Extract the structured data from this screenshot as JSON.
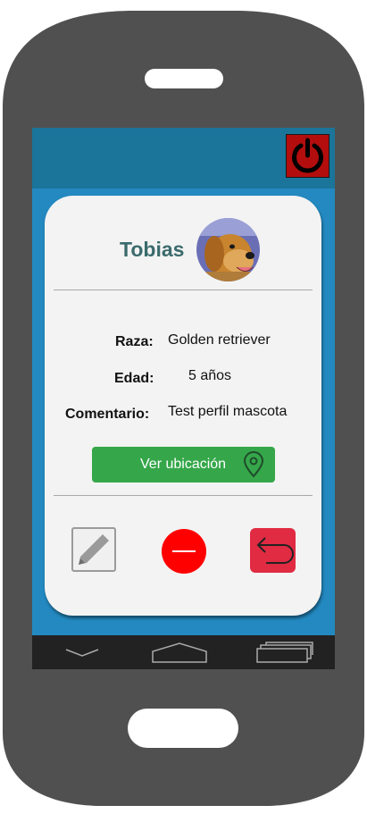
{
  "pet": {
    "name": "Tobias",
    "avatar_icon": "dog-photo"
  },
  "details": {
    "breed_label": "Raza:",
    "breed_value": "Golden retriever",
    "age_label": "Edad:",
    "age_value": "5 años",
    "comment_label": "Comentario:",
    "comment_value": "Test perfil mascota"
  },
  "actions": {
    "location_label": "Ver ubicación",
    "location_icon": "map-pin-icon",
    "edit_icon": "pencil-icon",
    "delete_icon": "minus-icon",
    "back_icon": "undo-arrow-icon",
    "power_icon": "power-icon"
  },
  "colors": {
    "topbar": "#1b7499",
    "screen_bg": "#2389c0",
    "card_bg": "#f3f3f3",
    "name": "#3b6b6c",
    "location_button": "#35a74a",
    "delete_button": "#ff0000",
    "back_button": "#e02b43",
    "power_button": "#b30d0d"
  },
  "navbar": {
    "back_icon": "chevron-down-icon",
    "home_icon": "home-icon",
    "recents_icon": "recents-icon"
  }
}
